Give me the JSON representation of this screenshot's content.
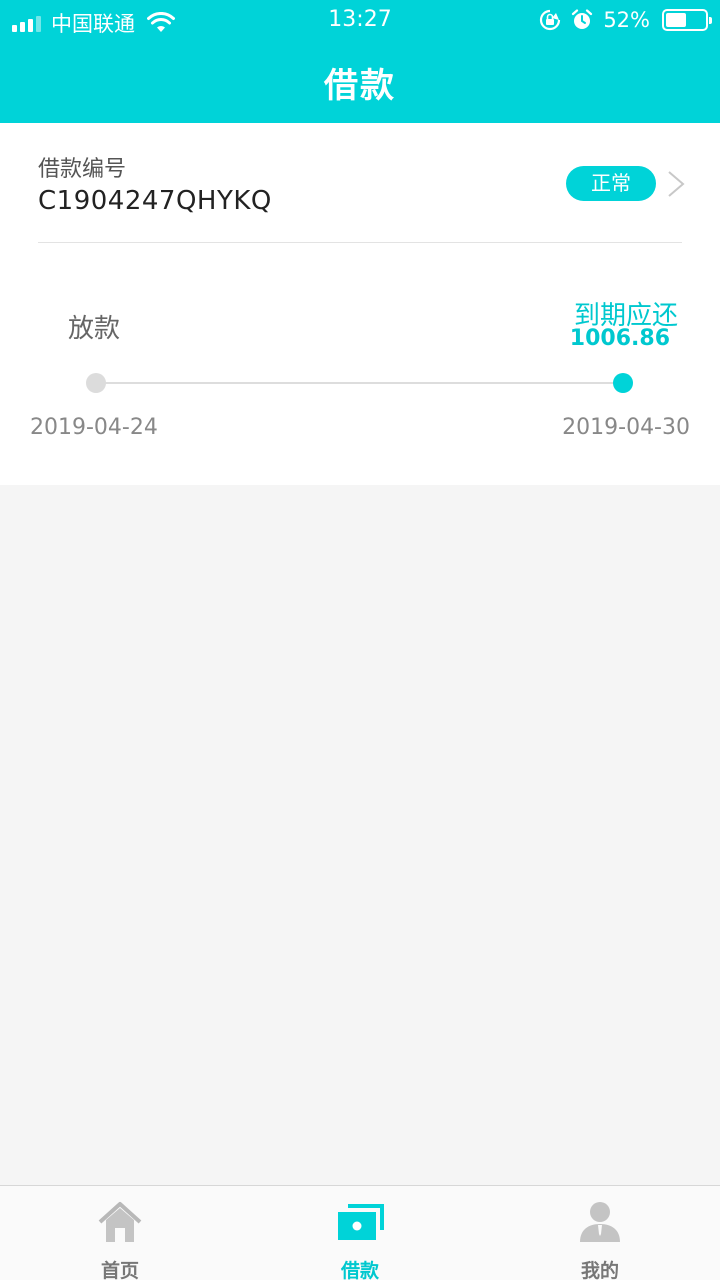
{
  "status_bar": {
    "carrier": "中国联通",
    "time": "13:27",
    "battery_percent": "52%",
    "battery_level": 0.52
  },
  "header": {
    "title": "借款"
  },
  "loan": {
    "number_label": "借款编号",
    "number": "C1904247QHYKQ",
    "status": "正常",
    "start_label": "放款",
    "due_label": "到期应还",
    "due_amount": "1006.86",
    "start_date": "2019-04-24",
    "due_date": "2019-04-30"
  },
  "tabbar": {
    "items": [
      {
        "label": "首页",
        "icon": "home-icon",
        "active": false
      },
      {
        "label": "借款",
        "icon": "loan-cash-icon",
        "active": true
      },
      {
        "label": "我的",
        "icon": "profile-icon",
        "active": false
      }
    ]
  },
  "colors": {
    "accent": "#00d3d8",
    "background": "#f5f5f5",
    "tab_inactive": "#777777"
  }
}
